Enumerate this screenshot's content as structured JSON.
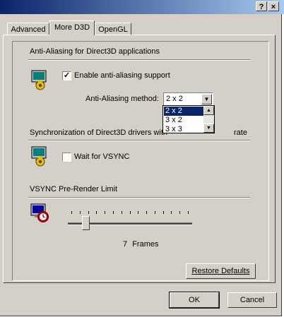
{
  "title_bar": {
    "help_label": "?",
    "close_label": "×"
  },
  "tabs": [
    {
      "label": "Advanced",
      "active": false
    },
    {
      "label": "More D3D",
      "active": true
    },
    {
      "label": "OpenGL",
      "active": false
    }
  ],
  "aa_section": {
    "heading": "Anti-Aliasing for Direct3D applications",
    "enable_label": "Enable anti-aliasing support",
    "enable_checked": true,
    "method_label": "Anti-Aliasing method:",
    "method_value": "2 x 2",
    "method_options": [
      "2 x 2",
      "3 x 2",
      "3 x 3"
    ],
    "method_selected_index": 0
  },
  "vsync_section": {
    "heading_visible": "Synchronization of Direct3D drivers with",
    "heading_tail": "rate",
    "wait_label": "Wait for VSYNC",
    "wait_checked": false
  },
  "prerender_section": {
    "heading": "VSYNC Pre-Render Limit",
    "value": "7",
    "unit": "Frames",
    "slider_fraction": 0.12,
    "tick_count": 15
  },
  "buttons": {
    "restore": "Restore Defaults",
    "ok": "OK",
    "cancel": "Cancel"
  },
  "icons": {
    "aa_icon": "monitor-gear-icon",
    "vsync_icon": "monitor-gear-icon",
    "prerender_icon": "monitor-clock-icon"
  },
  "colors": {
    "dialog": "#d4d0c8",
    "title_start": "#0a246a",
    "title_end": "#a6caf0",
    "selection": "#0a246a"
  }
}
